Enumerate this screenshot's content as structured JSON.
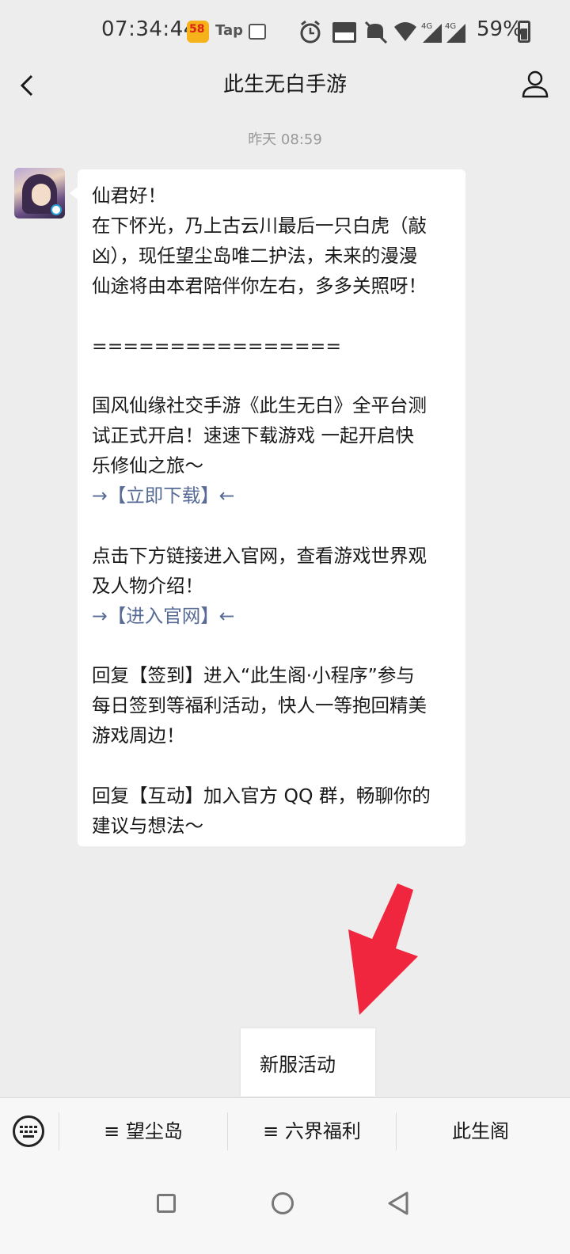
{
  "status_bar": {
    "time": "07:34:44",
    "app_58_label": "58",
    "tap_label": "Tap",
    "battery_percent": "59%"
  },
  "header": {
    "title": "此生无白手游"
  },
  "chat": {
    "timestamp": "昨天 08:59",
    "message_lines": [
      "仙君好！",
      "在下怀光，乃上古云川最后一只白虎（敲",
      "凶），现任望尘岛唯二护法，未来的漫漫",
      "仙途将由本君陪伴你左右，多多关照呀！",
      "",
      "================",
      "",
      "国风仙缘社交手游《此生无白》全平台测",
      "试正式开启！速速下载游戏 一起开启快",
      "乐修仙之旅～",
      "→【立即下载】←",
      "",
      "点击下方链接进入官网，查看游戏世界观",
      "及人物介绍！",
      "→【进入官网】←",
      "",
      "回复【签到】进入“此生阁·小程序”参与",
      "每日签到等福利活动，快人一等抱回精美",
      "游戏周边！",
      "",
      "回复【互动】加入官方 QQ 群，畅聊你的",
      "建议与想法～"
    ]
  },
  "popup_menu": {
    "item": "新服活动"
  },
  "bottom_menu": {
    "items": [
      "≡ 望尘岛",
      "≡ 六界福利",
      "此生阁"
    ]
  },
  "colors": {
    "background": "#ededed",
    "link": "#576b95",
    "arrow": "#f0263f"
  }
}
